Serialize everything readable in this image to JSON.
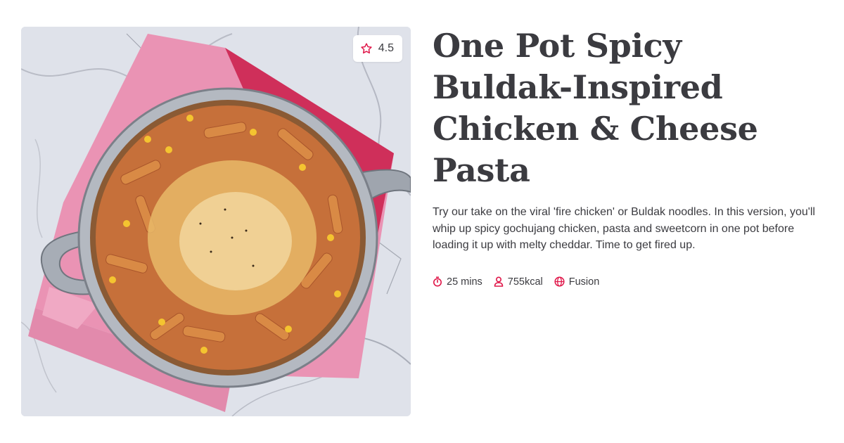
{
  "recipe": {
    "title": "One Pot Spicy Buldak-Inspired Chicken & Cheese Pasta",
    "description": "Try our take on the viral 'fire chicken' or Buldak noodles. In this version, you'll whip up spicy gochujang chicken, pasta and sweetcorn in one pot before loading it up with melty cheddar. Time to get fired up.",
    "rating": "4.5",
    "image_alt": "Spicy chicken and cheese pasta in a pan on a pink napkin",
    "meta": {
      "time": "25 mins",
      "calories": "755kcal",
      "cuisine": "Fusion"
    }
  },
  "icons": {
    "rating": "star-icon",
    "time": "timer-icon",
    "calories": "person-icon",
    "cuisine": "globe-icon"
  },
  "colors": {
    "accent": "#e0184a",
    "text": "#3b3b40",
    "badge_bg": "#ffffff"
  }
}
